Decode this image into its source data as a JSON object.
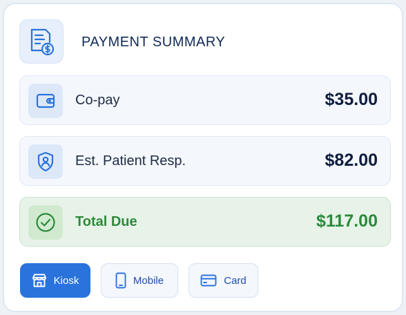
{
  "header": {
    "title": "PAYMENT SUMMARY",
    "icon": "receipt-dollar-icon"
  },
  "rows": [
    {
      "label": "Co-pay",
      "amount": "$35.00",
      "icon": "wallet-icon"
    },
    {
      "label": "Est. Patient Resp.",
      "amount": "$82.00",
      "icon": "shield-user-icon"
    },
    {
      "label": "Total Due",
      "amount": "$117.00",
      "icon": "check-circle-icon"
    }
  ],
  "payment_methods": [
    {
      "label": "Kiosk",
      "icon": "store-icon",
      "selected": true
    },
    {
      "label": "Mobile",
      "icon": "phone-icon",
      "selected": false
    },
    {
      "label": "Card",
      "icon": "credit-card-icon",
      "selected": false
    }
  ],
  "colors": {
    "accent": "#2a73dc",
    "total_green": "#2c8a3a",
    "dark_text": "#0e1d3d"
  }
}
